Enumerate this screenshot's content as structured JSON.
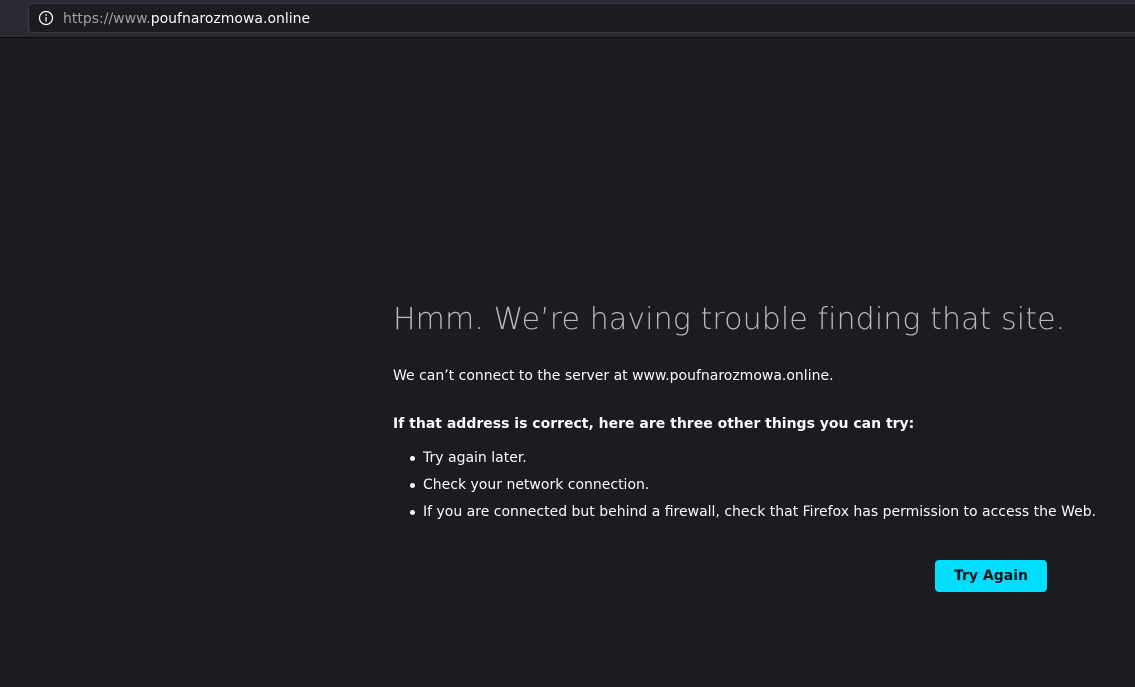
{
  "browser": {
    "url_scheme": "https://www.",
    "url_host": "poufnarozmowa.online",
    "site_info_icon": "info-icon"
  },
  "error_page": {
    "title": "Hmm. We’re having trouble finding that site.",
    "description": "We can’t connect to the server at www.poufnarozmowa.online.",
    "subheading": "If that address is correct, here are three other things you can try:",
    "suggestions": [
      "Try again later.",
      "Check your network connection.",
      "If you are connected but behind a firewall, check that Firefox has permission to access the Web."
    ],
    "try_again_label": "Try Again"
  },
  "colors": {
    "background": "#1c1b22",
    "accent_button": "#00ddff",
    "text": "#fbfbfe",
    "title_text": "#b9b9be"
  }
}
